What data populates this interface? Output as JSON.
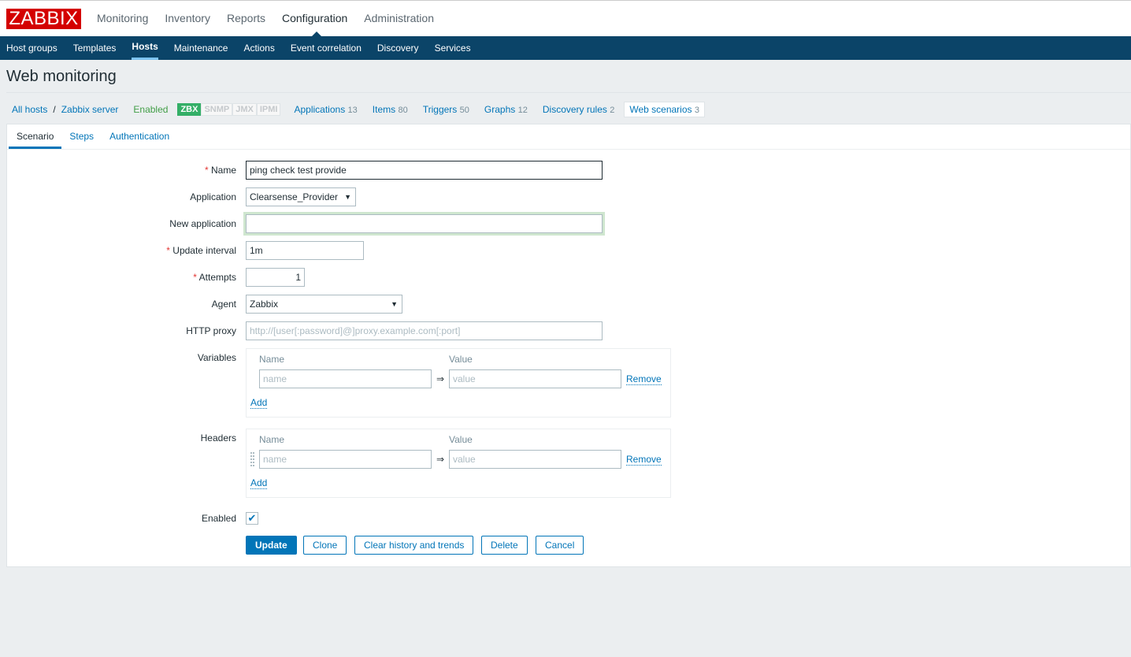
{
  "logo": "ZABBIX",
  "main_menu": [
    "Monitoring",
    "Inventory",
    "Reports",
    "Configuration",
    "Administration"
  ],
  "sub_menu": [
    "Host groups",
    "Templates",
    "Hosts",
    "Maintenance",
    "Actions",
    "Event correlation",
    "Discovery",
    "Services"
  ],
  "page_title": "Web monitoring",
  "host_nav": {
    "all_hosts": "All hosts",
    "sep": "/",
    "host": "Zabbix server",
    "status": "Enabled",
    "badges": [
      "ZBX",
      "SNMP",
      "JMX",
      "IPMI"
    ],
    "links": [
      {
        "label": "Applications",
        "count": "13"
      },
      {
        "label": "Items",
        "count": "80"
      },
      {
        "label": "Triggers",
        "count": "50"
      },
      {
        "label": "Graphs",
        "count": "12"
      },
      {
        "label": "Discovery rules",
        "count": "2"
      },
      {
        "label": "Web scenarios",
        "count": "3"
      }
    ]
  },
  "tabs": [
    "Scenario",
    "Steps",
    "Authentication"
  ],
  "form": {
    "name_label": "Name",
    "name_value": "ping check test provide",
    "application_label": "Application",
    "application_value": "Clearsense_Provider",
    "new_application_label": "New application",
    "interval_label": "Update interval",
    "interval_value": "1m",
    "attempts_label": "Attempts",
    "attempts_value": "1",
    "agent_label": "Agent",
    "agent_value": "Zabbix",
    "proxy_label": "HTTP proxy",
    "proxy_placeholder": "http://[user[:password]@]proxy.example.com[:port]",
    "variables_label": "Variables",
    "headers_label": "Headers",
    "col_name": "Name",
    "col_value": "Value",
    "name_placeholder": "name",
    "value_placeholder": "value",
    "arrow": "⇒",
    "remove": "Remove",
    "add": "Add",
    "enabled_label": "Enabled",
    "buttons": [
      "Update",
      "Clone",
      "Clear history and trends",
      "Delete",
      "Cancel"
    ]
  }
}
